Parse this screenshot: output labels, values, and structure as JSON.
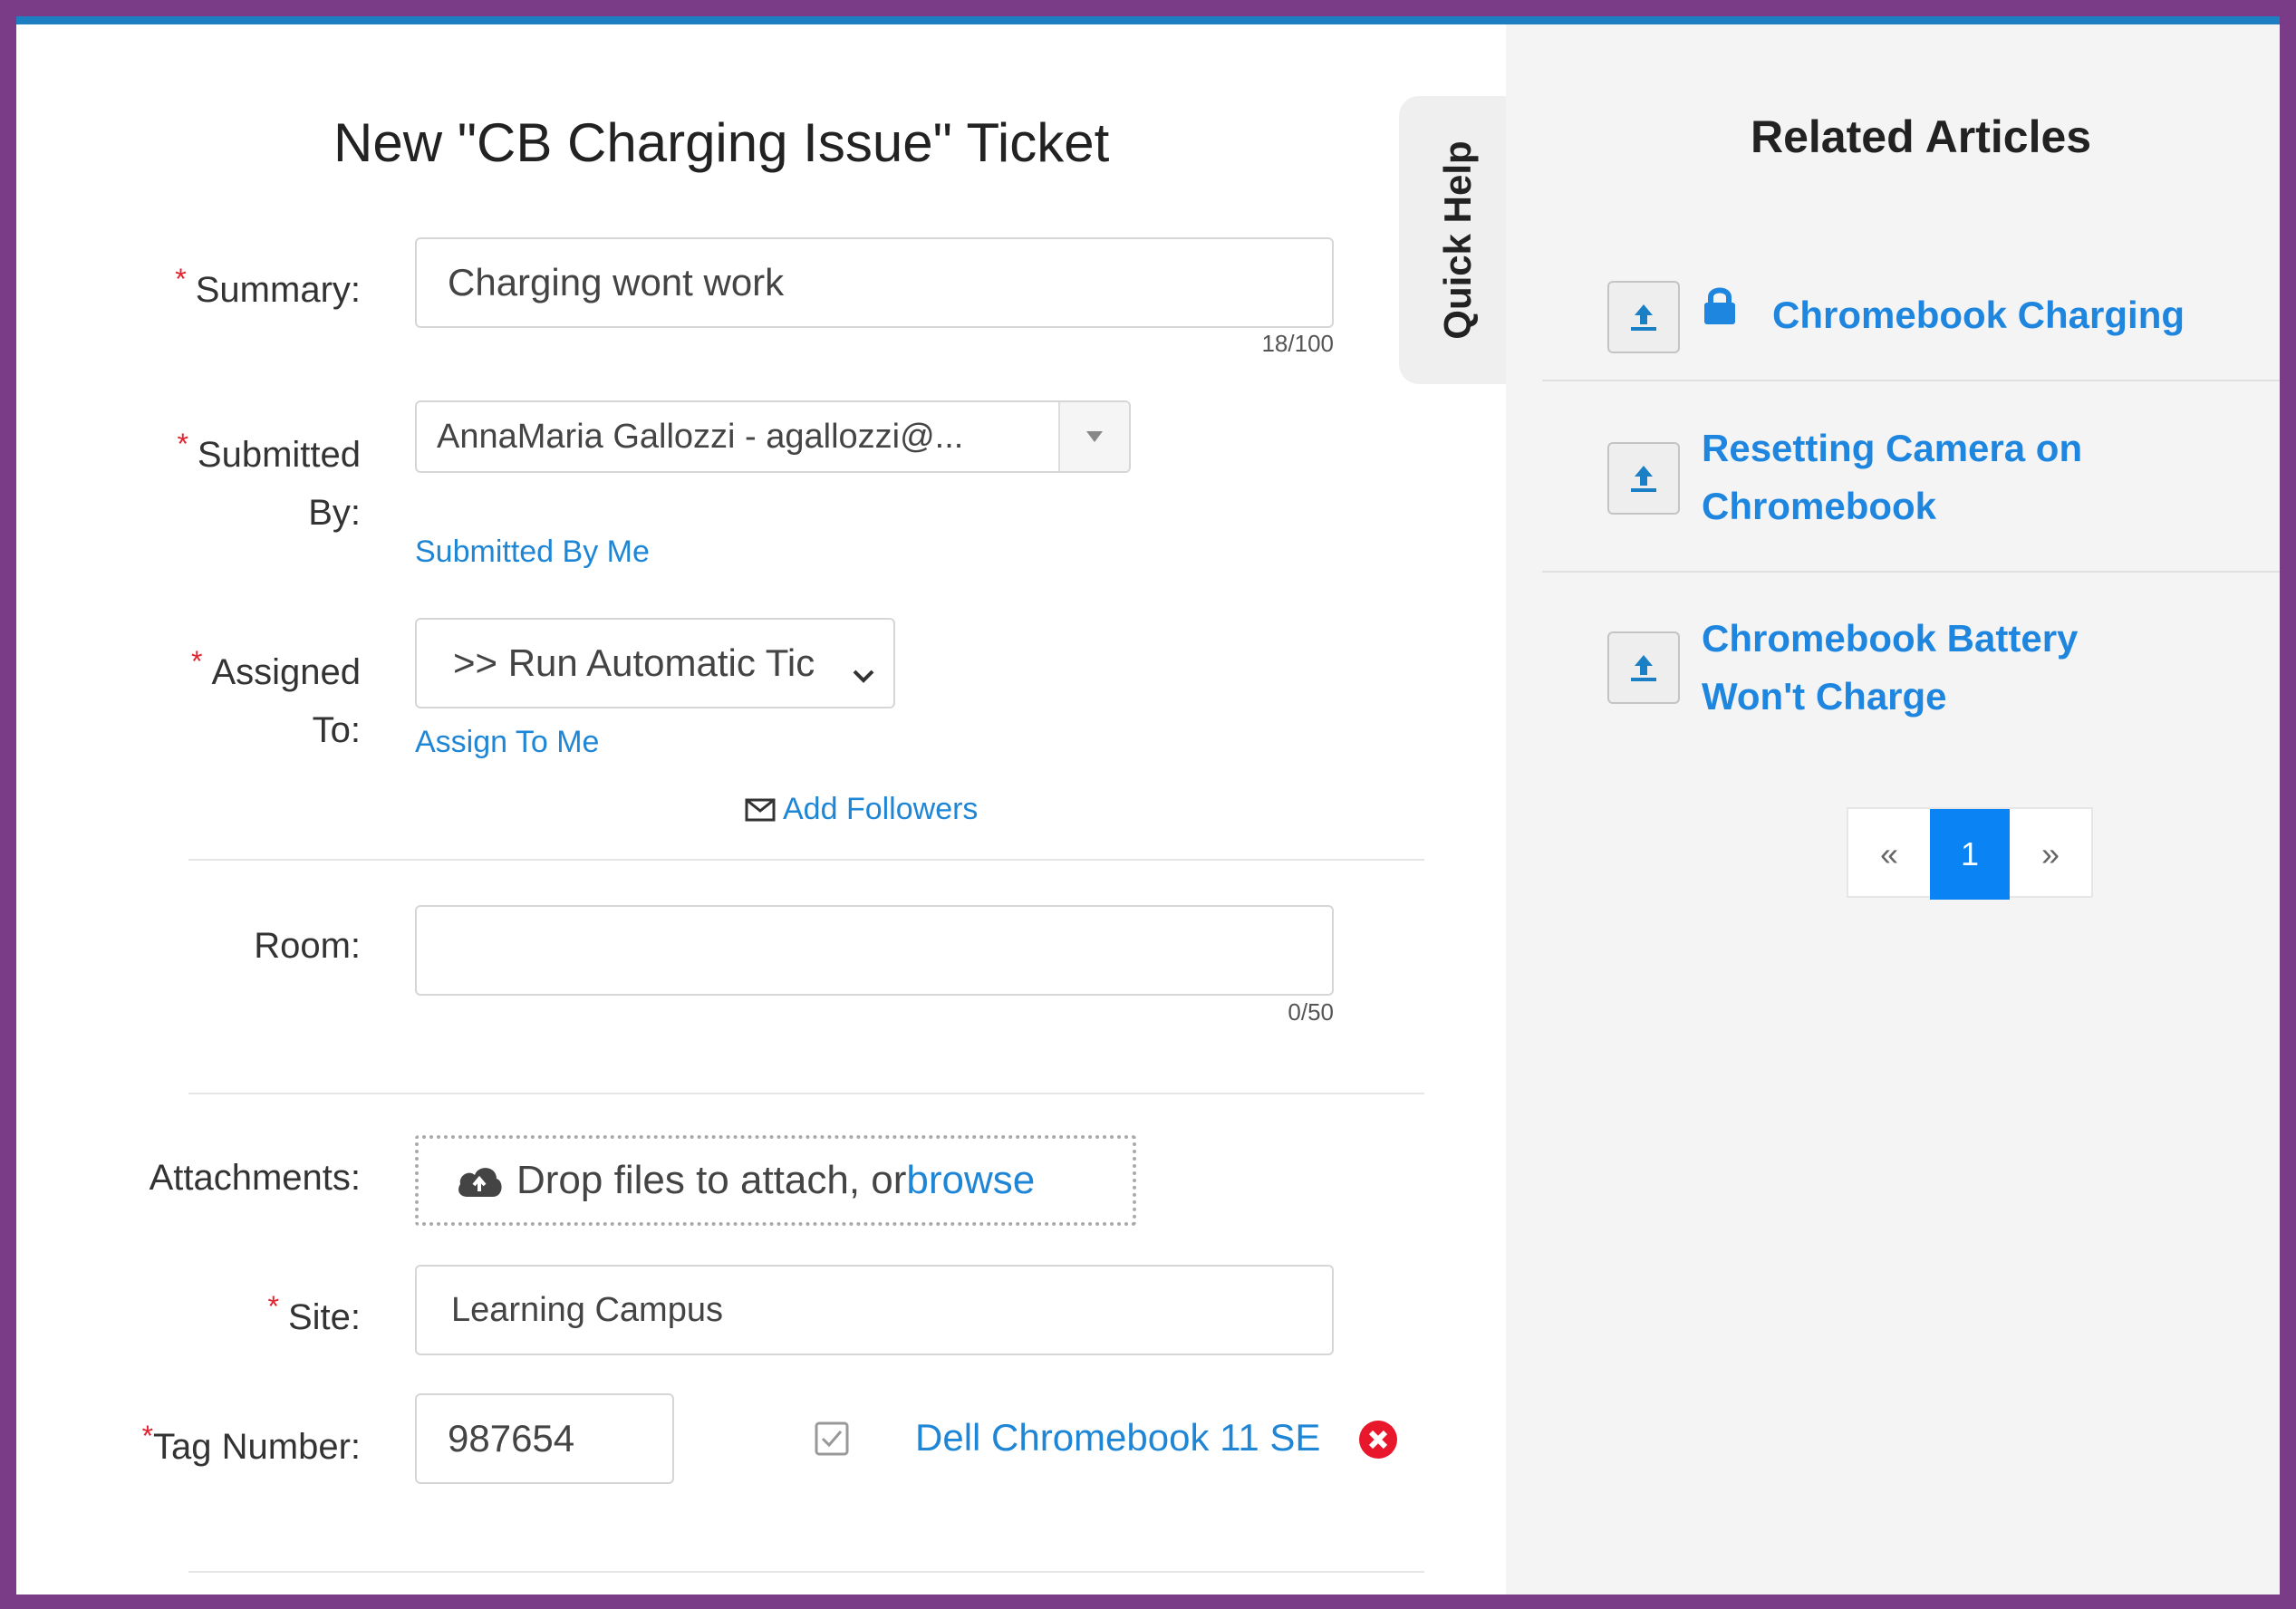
{
  "form": {
    "title": "New \"CB Charging Issue\" Ticket",
    "required_marker": "*",
    "summary": {
      "label": "Summary:",
      "value": "Charging wont work",
      "counter": "18/100"
    },
    "submitted_by": {
      "label_line1": "Submitted",
      "label_line2": "By:",
      "value": "AnnaMaria Gallozzi - agallozzi@...",
      "link": "Submitted By Me"
    },
    "assigned_to": {
      "label_line1": "Assigned",
      "label_line2": "To:",
      "value": ">> Run Automatic Tic",
      "link": "Assign To Me"
    },
    "add_followers": "Add Followers",
    "room": {
      "label": "Room:",
      "value": "",
      "counter": "0/50"
    },
    "attachments": {
      "label": "Attachments:",
      "text": "Drop files to attach, or",
      "browse": "browse"
    },
    "site": {
      "label": "Site:",
      "value": "Learning Campus"
    },
    "tag_number": {
      "label": "Tag Number:",
      "value": "987654",
      "asset_link": "Dell Chromebook 11 SE"
    }
  },
  "quick_help": {
    "label": "Quick Help"
  },
  "related_articles": {
    "title": "Related Articles",
    "articles": [
      {
        "line1": "Chromebook Charging",
        "line2": "",
        "locked": true
      },
      {
        "line1": "Resetting Camera on",
        "line2": "Chromebook",
        "locked": false
      },
      {
        "line1": "Chromebook Battery",
        "line2": "Won't Charge",
        "locked": false
      }
    ],
    "pagination": {
      "prev": "«",
      "current": "1",
      "next": "»"
    }
  },
  "colors": {
    "border": "#7a3c86",
    "top_bar": "#1d7fc1",
    "link": "#1f86d6",
    "required": "#e0232e",
    "active_page": "#0a84f5"
  },
  "icons": [
    "caret-down-icon",
    "select-chevron-icon",
    "envelope-icon",
    "cloud-upload-icon",
    "checkbox-icon",
    "remove-circle-icon",
    "upload-icon",
    "lock-icon"
  ]
}
